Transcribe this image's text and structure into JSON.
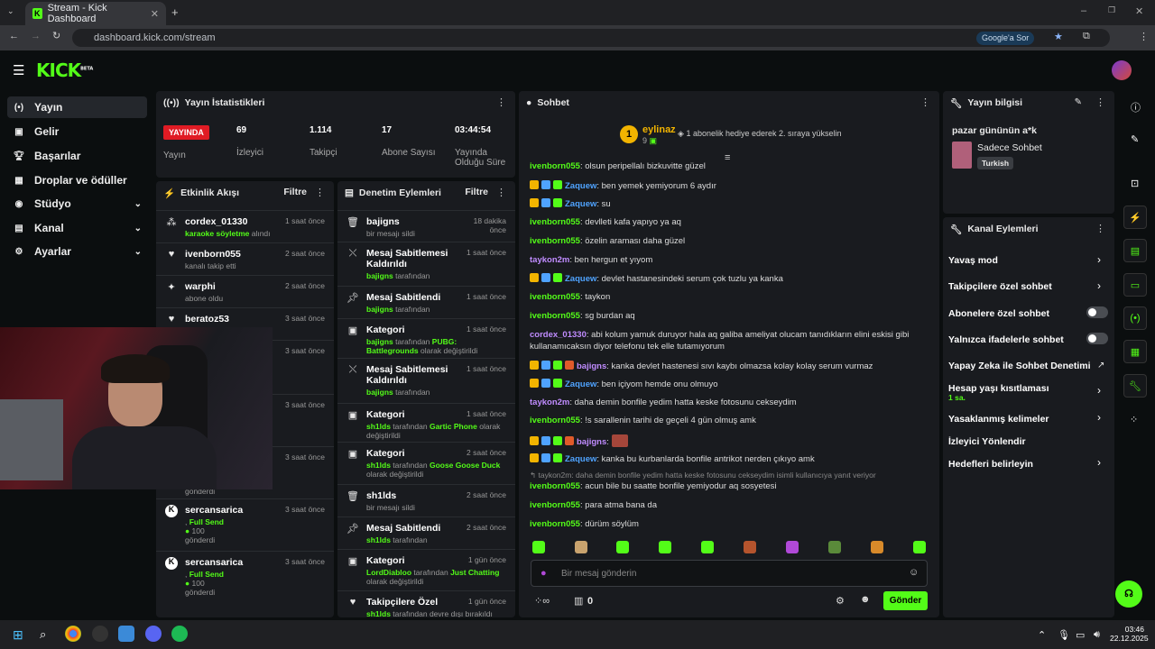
{
  "browser": {
    "tab_title": "Stream - Kick Dashboard",
    "url": "dashboard.kick.com/stream",
    "google_btn": "Google'a Sor"
  },
  "app": {
    "logo": "KICK",
    "beta": "BETA"
  },
  "sidebar": {
    "items": [
      {
        "label": "Yayın",
        "icon": "broadcast-icon"
      },
      {
        "label": "Gelir",
        "icon": "money-icon"
      },
      {
        "label": "Başarılar",
        "icon": "trophy-icon"
      },
      {
        "label": "Droplar ve ödüller",
        "icon": "gift-icon"
      },
      {
        "label": "Stüdyo",
        "icon": "studio-icon"
      },
      {
        "label": "Kanal",
        "icon": "channel-icon"
      },
      {
        "label": "Ayarlar",
        "icon": "gear-icon"
      }
    ]
  },
  "stats": {
    "title": "Yayın İstatistikleri",
    "live": "YAYINDA",
    "live_label": "Yayın",
    "viewers": "69",
    "viewers_label": "İzleyici",
    "followers": "1.114",
    "followers_label": "Takipçi",
    "subs": "17",
    "subs_label": "Abone Sayısı",
    "uptime": "03:44:54",
    "uptime_label": "Yayında Olduğu Süre"
  },
  "activity": {
    "title": "Etkinlik Akışı",
    "filter": "Filtre",
    "items": [
      {
        "name": "cordex_01330",
        "sub_g": "karaoke söyletme",
        "sub": " alındı",
        "time": "1 saat önce"
      },
      {
        "name": "ivenborn055",
        "sub_g": "",
        "sub": "kanalı takip etti",
        "time": "2 saat önce"
      },
      {
        "name": "warphi",
        "sub_g": "",
        "sub": "abone oldu",
        "time": "2 saat önce"
      },
      {
        "name": "beratoz53",
        "sub_g": "",
        "sub": "kanalı takip etti",
        "time": "3 saat önce"
      },
      {
        "name": "",
        "sub_g": "",
        "sub": "",
        "time": "3 saat önce"
      },
      {
        "name": "",
        "sub_g": "",
        "sub": "",
        "time": "3 saat önce"
      },
      {
        "name": "",
        "sub_g": "",
        "sub": "gönderdi",
        "time": "3 saat önce"
      },
      {
        "name": "sercansarica",
        "sub_g": "Full Send",
        "sub": "100",
        "extra": "gönderdi",
        "time": "3 saat önce"
      },
      {
        "name": "sercansarica",
        "sub_g": "Full Send",
        "sub": "100",
        "extra": "gönderdi",
        "time": "3 saat önce"
      }
    ]
  },
  "moderation": {
    "title": "Denetim Eylemleri",
    "filter": "Filtre",
    "items": [
      {
        "name": "bajigns",
        "a": "bir mesajı sildi",
        "g": "",
        "b": "",
        "time": "18 dakika önce"
      },
      {
        "name": "Mesaj Sabitlemesi Kaldırıldı",
        "a": "",
        "g": "bajigns",
        "b": " tarafından",
        "time": "1 saat önce"
      },
      {
        "name": "Mesaj Sabitlendi",
        "a": "",
        "g": "bajigns",
        "b": " tarafından",
        "time": "1 saat önce"
      },
      {
        "name": "Kategori",
        "a": "",
        "g": "bajigns",
        "b": " tarafından ",
        "g2": "PUBG: Battlegrounds",
        "c": " olarak değiştirildi",
        "time": "1 saat önce"
      },
      {
        "name": "Mesaj Sabitlemesi Kaldırıldı",
        "a": "",
        "g": "bajigns",
        "b": " tarafından",
        "time": "1 saat önce"
      },
      {
        "name": "Kategori",
        "a": "",
        "g": "sh1lds",
        "b": " tarafından ",
        "g2": "Gartic Phone",
        "c": " olarak değiştirildi",
        "time": "1 saat önce"
      },
      {
        "name": "Kategori",
        "a": "",
        "g": "sh1lds",
        "b": " tarafından ",
        "g2": "Goose Goose Duck",
        "c": " olarak değiştirildi",
        "time": "2 saat önce"
      },
      {
        "name": "sh1lds",
        "a": "bir mesajı sildi",
        "g": "",
        "b": "",
        "time": "2 saat önce"
      },
      {
        "name": "Mesaj Sabitlendi",
        "a": "",
        "g": "sh1lds",
        "b": " tarafından",
        "time": "2 saat önce"
      },
      {
        "name": "Kategori",
        "a": "",
        "g": "LordDiabloo",
        "b": " tarafından ",
        "g2": "Just Chatting",
        "c": " olarak değiştirildi",
        "time": "1 gün önce"
      },
      {
        "name": "Takipçilere Özel",
        "a": "",
        "g": "sh1lds",
        "b": " tarafından devre dışı bırakıldı",
        "time": "1 gün önce"
      }
    ]
  },
  "chat": {
    "title": "Sohbet",
    "pinned_user": "eylinaz",
    "pinned_count": "9",
    "pinned_rank": "1",
    "gift_msg": "1 abonelik hediye ederek 2. sıraya yükselin",
    "messages": [
      {
        "u": "ivenborn055",
        "c": "#53fc18",
        "t": ": olsun peripellalı bizkuvitte güzel"
      },
      {
        "u": "Zaquew",
        "c": "#4fa3ff",
        "t": ": ben yemek yemiyorum 6 aydır",
        "badges": 3
      },
      {
        "u": "Zaquew",
        "c": "#4fa3ff",
        "t": ": su",
        "badges": 3
      },
      {
        "u": "ivenborn055",
        "c": "#53fc18",
        "t": ": devlleti kafa yapıyo ya aq"
      },
      {
        "u": "ivenborn055",
        "c": "#53fc18",
        "t": ": özelin araması daha güzel"
      },
      {
        "u": "taykon2m",
        "c": "#c08cff",
        "t": ": ben hergun et yıyom"
      },
      {
        "u": "Zaquew",
        "c": "#4fa3ff",
        "t": ": devlet hastanesindeki serum çok tuzlu ya kanka",
        "badges": 3
      },
      {
        "u": "ivenborn055",
        "c": "#53fc18",
        "t": ": taykon"
      },
      {
        "u": "ivenborn055",
        "c": "#53fc18",
        "t": ": sg burdan aq"
      },
      {
        "u": "cordex_01330",
        "c": "#c08cff",
        "t": ": abi kolum yamuk duruyor hala aq galiba ameliyat olucam tanıdıkların elini eskisi gibi"
      },
      {
        "u": "",
        "c": "#ddd",
        "t": "kullanamıcaksın diyor telefonu tek elle tutamıyorum"
      },
      {
        "u": "bajigns",
        "c": "#c08cff",
        "t": ": kanka devlet hastenesi sıvı kaybı olmazsa kolay kolay serum vurmaz",
        "badges": 4
      },
      {
        "u": "Zaquew",
        "c": "#4fa3ff",
        "t": ": ben içiyom hemde onu olmuyo",
        "badges": 3
      },
      {
        "u": "taykon2m",
        "c": "#c08cff",
        "t": ": daha demin bonfile yedim hatta keske fotosunu cekseydim"
      },
      {
        "u": "ivenborn055",
        "c": "#53fc18",
        "t": ": !s sarallenin tarihi de geçeli 4 gün olmuş amk"
      },
      {
        "u": "bajigns",
        "c": "#c08cff",
        "t": ":",
        "badges": 4
      },
      {
        "u": "Zaquew",
        "c": "#4fa3ff",
        "t": ": kanka bu kurbanlarda bonfile antrikot nerden çıkıyo amk",
        "badges": 3
      },
      {
        "u": "",
        "c": "#888",
        "t": "↰ taykon2m: daha demin bonfile yedim hatta keske fotosunu cekseydim isimli kullanıcıya yanıt veriyor"
      },
      {
        "u": "ivenborn055",
        "c": "#53fc18",
        "t": ": acun bile bu saatte bonfile yemiyodur aq sosyetesi"
      },
      {
        "u": "ivenborn055",
        "c": "#53fc18",
        "t": ": para atma bana da"
      },
      {
        "u": "ivenborn055",
        "c": "#53fc18",
        "t": ": dürüm söylüm"
      }
    ],
    "placeholder": "Bir mesaj gönderin",
    "points": "0",
    "send": "Gönder"
  },
  "info": {
    "title": "Yayın bilgisi",
    "stream_title": "pazar gününün a*k",
    "mode": "Sadece Sohbet",
    "lang": "Turkish"
  },
  "actions": {
    "title": "Kanal Eylemleri",
    "items": [
      {
        "label": "Yavaş mod",
        "kind": "chevron"
      },
      {
        "label": "Takipçilere özel sohbet",
        "kind": "chevron"
      },
      {
        "label": "Abonelere özel sohbet",
        "kind": "toggle"
      },
      {
        "label": "Yalnızca ifadelerle sohbet",
        "kind": "toggle"
      },
      {
        "label": "Yapay Zeka ile Sohbet Denetimi",
        "kind": "link"
      },
      {
        "label": "Hesap yaşı kısıtlaması",
        "sub": "1 sa.",
        "kind": "chevron"
      },
      {
        "label": "Yasaklanmış kelimeler",
        "kind": "chevron"
      },
      {
        "label": "İzleyici Yönlendir",
        "kind": "none"
      },
      {
        "label": "Hedefleri belirleyin",
        "kind": "chevron"
      }
    ]
  },
  "taskbar": {
    "time": "03:46",
    "date": "22.12.2025"
  }
}
